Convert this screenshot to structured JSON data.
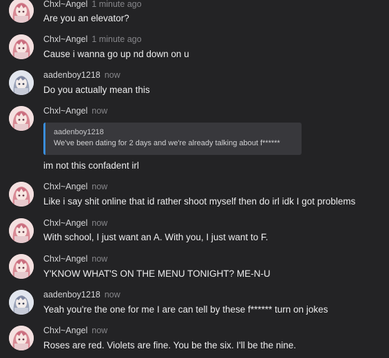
{
  "users": {
    "chxl": "Chxl~Angel",
    "aaden": "aadenboy1218"
  },
  "colors": {
    "background": "#232325",
    "quote_accent": "#3a8edc",
    "quote_bg": "#38383c"
  },
  "messages": [
    {
      "author": "Chxl~Angel",
      "time": "1 minute ago",
      "text": "Are you an elevator?"
    },
    {
      "author": "Chxl~Angel",
      "time": "1 minute ago",
      "text": "Cause i wanna go up nd down on u"
    },
    {
      "author": "aadenboy1218",
      "time": "now",
      "text": "Do you actually mean this"
    },
    {
      "author": "Chxl~Angel",
      "time": "now",
      "text": "im not this confadent irl",
      "reply": {
        "author": "aadenboy1218",
        "text": "We've been dating for 2 days and we're already talking about f******"
      }
    },
    {
      "author": "Chxl~Angel",
      "time": "now",
      "text": "Like i say shit online that id rather shoot myself then do irl idk I got problems"
    },
    {
      "author": "Chxl~Angel",
      "time": "now",
      "text": "With school, I just want an A. With you, I just want to F."
    },
    {
      "author": "Chxl~Angel",
      "time": "now",
      "text": "Y'KNOW WHAT'S ON THE MENU TONIGHT? ME-N-U"
    },
    {
      "author": "aadenboy1218",
      "time": "now",
      "text": "Yeah you're the one for me I are can tell by these f****** turn on jokes"
    },
    {
      "author": "Chxl~Angel",
      "time": "now",
      "text": "Roses are red. Violets are fine. You be the six. I'll be the nine."
    }
  ]
}
